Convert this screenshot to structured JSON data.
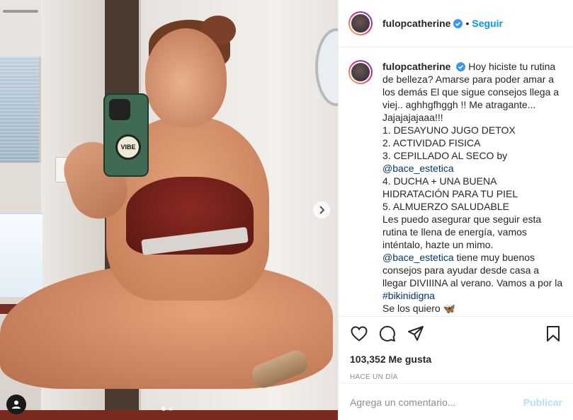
{
  "post": {
    "photo_alt_icon": "person-tag-icon",
    "carousel": {
      "current": 1,
      "total": 2
    },
    "popsocket_text": "VIBE"
  },
  "header": {
    "username": "fulopcatherine",
    "verified": true,
    "separator": "•",
    "follow_label": "Seguir"
  },
  "caption": {
    "username": "fulopcatherine",
    "lines": [
      "Hoy hiciste tu rutina de belleza? Amarse para poder amar a los demás El que sigue consejos llega a viej.. aghhgfhggh !! Me atragante... Jajajajajaaa!!!",
      "1. DESAYUNO JUGO DETOX",
      "2. ACTIVIDAD FISICA",
      "3. CEPILLADO AL SECO by",
      "@bace_estetica",
      "4. DUCHA + UNA BUENA HIDRATACIÓN PARA TU PIEL",
      "5. ALMUERZO SALUDABLE",
      "Les puedo asegurar que seguir esta rutina te llena de energía, vamos inténtalo, hazte un mimo.",
      "@bace_estetica",
      " tiene muy buenos consejos para ayudar desde casa a llegar DIVIIINA al verano. Vamos a por la ",
      "#bikinidigna",
      "Se los quiero 🦋"
    ]
  },
  "actions": {
    "icons": [
      "heart-icon",
      "comment-icon",
      "share-icon",
      "bookmark-icon"
    ],
    "likes_text": "103,352 Me gusta",
    "time_text": "HACE UN DÍA"
  },
  "comment": {
    "placeholder": "Agrega un comentario...",
    "publish_label": "Publicar"
  },
  "colors": {
    "link": "#00376b",
    "follow": "#0095f6",
    "publish_disabled": "#b2dffc",
    "verified": "#3897f0"
  }
}
